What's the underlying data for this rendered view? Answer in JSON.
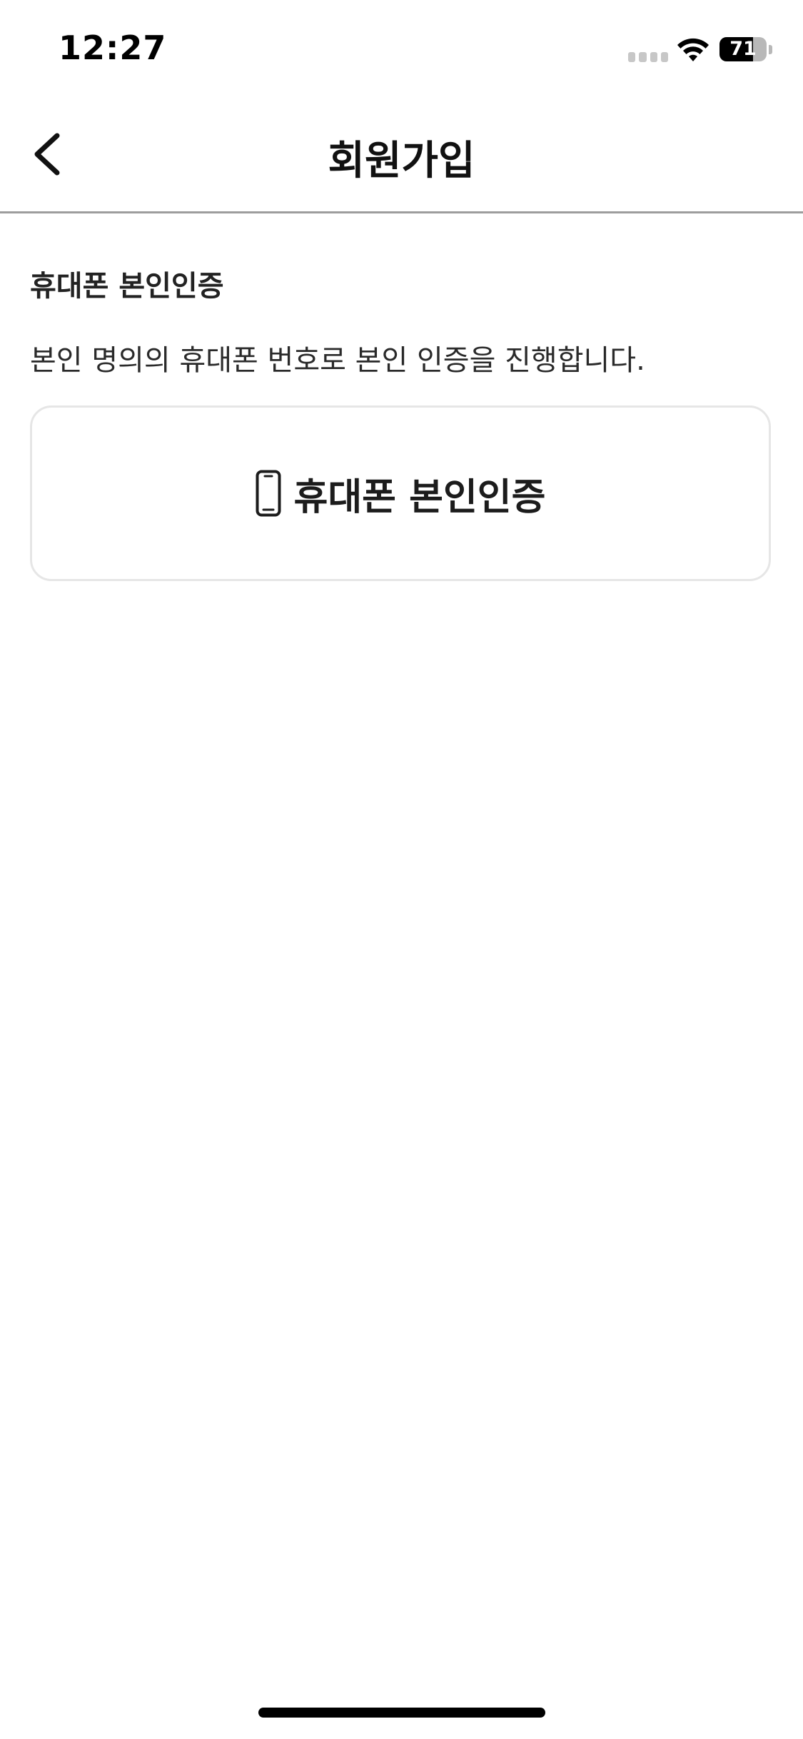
{
  "status_bar": {
    "time": "12:27",
    "battery_level": "71",
    "icons": [
      "cell-signal-icon",
      "wifi-icon",
      "battery-icon"
    ]
  },
  "nav": {
    "title": "회원가입",
    "back_icon": "chevron-left-icon"
  },
  "section": {
    "title": "휴대폰 본인인증",
    "description": "본인 명의의 휴대폰 번호로 본인 인증을 진행합니다."
  },
  "verify_button": {
    "label": "휴대폰 본인인증",
    "icon": "smartphone-icon"
  },
  "colors": {
    "background": "#ffffff",
    "text": "#1a1a1a",
    "divider": "#9d9d9d",
    "button_border": "#e6e6e6"
  }
}
